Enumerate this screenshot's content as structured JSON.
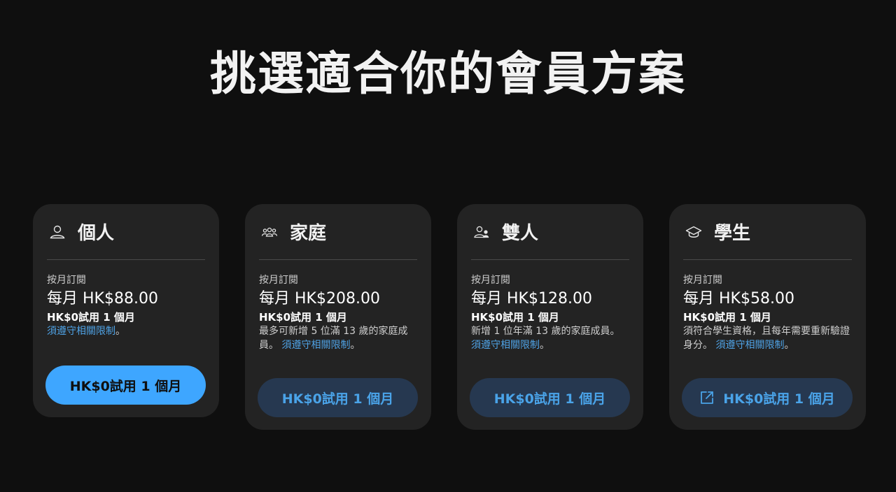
{
  "page": {
    "title": "挑選適合你的會員方案"
  },
  "plans": [
    {
      "icon": "person-icon",
      "name": "個人",
      "billing": "按月訂閱",
      "price": "每月 HK$88.00",
      "trial": "HK$0試用 1 個月",
      "description": "",
      "terms_link": "須遵守相關限制",
      "terms_suffix": "。",
      "cta_label": "HK$0試用 1 個月"
    },
    {
      "icon": "family-icon",
      "name": "家庭",
      "billing": "按月訂閱",
      "price": "每月 HK$208.00",
      "trial": "HK$0試用 1 個月",
      "description": "最多可新增 5 位滿 13 歲的家庭成員。 ",
      "terms_link": "須遵守相關限制",
      "terms_suffix": "。",
      "cta_label": "HK$0試用 1 個月"
    },
    {
      "icon": "duo-icon",
      "name": "雙人",
      "billing": "按月訂閱",
      "price": "每月 HK$128.00",
      "trial": "HK$0試用 1 個月",
      "description": "新增 1 位年滿 13 歲的家庭成員。 ",
      "terms_link": "須遵守相關限制",
      "terms_suffix": "。",
      "cta_label": "HK$0試用 1 個月"
    },
    {
      "icon": "graduation-cap-icon",
      "name": "學生",
      "billing": "按月訂閱",
      "price": "每月 HK$58.00",
      "trial": "HK$0試用 1 個月",
      "description": "須符合學生資格，且每年需要重新驗證身分。 ",
      "terms_link": "須遵守相關限制",
      "terms_suffix": "。",
      "cta_label": "HK$0試用 1 個月",
      "cta_icon": "external-link-icon"
    }
  ],
  "colors": {
    "background": "#0f0f0f",
    "card": "#232323",
    "accent": "#3ea6ff",
    "link": "#4fa3e6",
    "secondary_button": "#263850"
  }
}
